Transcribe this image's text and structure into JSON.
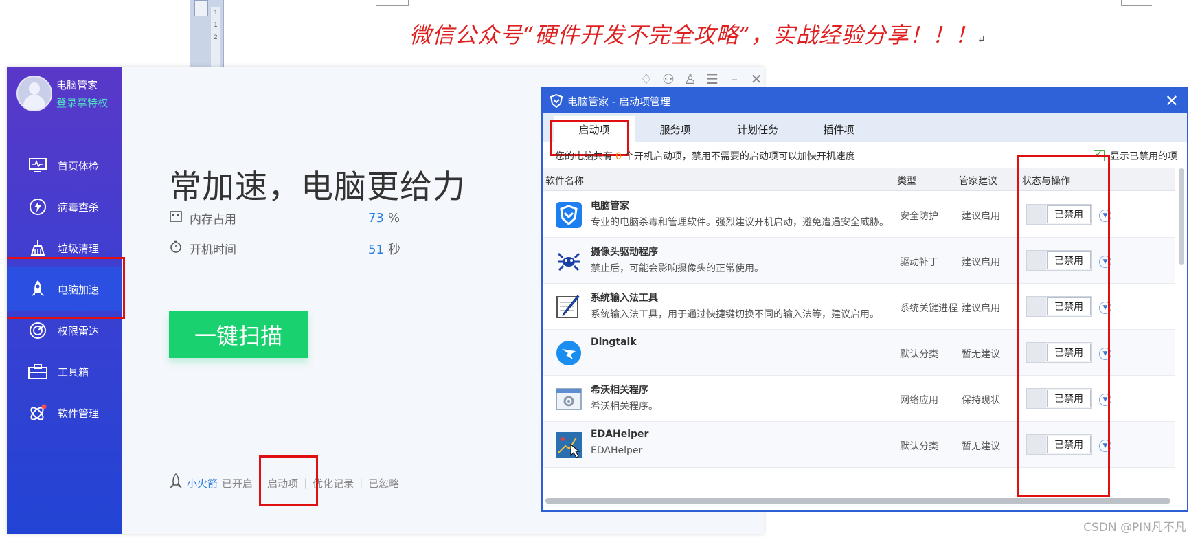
{
  "document": {
    "headline": "微信公众号“硬件开发不完全攻略”，实战经验分享！！！",
    "paragraph_mark": "↵",
    "ruler_ticks": [
      "1",
      "1",
      "2"
    ],
    "watermark": "CSDN @PIN凡不凡"
  },
  "app": {
    "user": {
      "name": "电脑管家",
      "login": "登录享特权"
    },
    "nav": [
      {
        "label": "首页体检",
        "icon": "monitor-check-icon"
      },
      {
        "label": "病毒查杀",
        "icon": "lightning-shield-icon"
      },
      {
        "label": "垃圾清理",
        "icon": "broom-icon"
      },
      {
        "label": "电脑加速",
        "icon": "rocket-icon",
        "active": true
      },
      {
        "label": "权限雷达",
        "icon": "radar-icon"
      },
      {
        "label": "工具箱",
        "icon": "toolbox-icon"
      },
      {
        "label": "软件管理",
        "icon": "apps-icon"
      }
    ],
    "main": {
      "title": "常加速，电脑更给力",
      "memory_label": "内存占用",
      "memory_value": "73",
      "memory_unit": "%",
      "boot_label": "开机时间",
      "boot_value": "51",
      "boot_unit": "秒",
      "scan_button": "一键扫描",
      "footer": {
        "rocket_link": "小火箭",
        "rocket_status": "已开启",
        "startup_link": "启动项",
        "history_link": "优化记录",
        "ignored_link": "已忽略"
      }
    }
  },
  "dialog": {
    "title": "电脑管家 - 启动项管理",
    "close": "✕",
    "tabs": [
      "启动项",
      "服务项",
      "计划任务",
      "插件项"
    ],
    "active_tab": "启动项",
    "info_prefix": "您的电脑共有",
    "info_count": "0",
    "info_suffix": "个开机启动项，禁用不需要的启动项可以加快开机速度",
    "show_disabled": "显示已禁用的项",
    "columns": {
      "name": "软件名称",
      "type": "类型",
      "advice": "管家建议",
      "status": "状态与操作"
    },
    "rows": [
      {
        "name": "电脑管家",
        "desc": "专业的电脑杀毒和管理软件。强烈建议开机启动，避免遭遇安全威胁。",
        "type": "安全防护",
        "advice": "建议启用",
        "status": "已禁用",
        "icon": "tencent-shield-icon"
      },
      {
        "name": "摄像头驱动程序",
        "desc": "禁止后，可能会影响摄像头的正常使用。",
        "type": "驱动补丁",
        "advice": "建议启用",
        "status": "已禁用",
        "icon": "realtek-crab-icon"
      },
      {
        "name": "系统输入法工具",
        "desc": "系统输入法工具，用于通过快捷键切换不同的输入法等，建议启用。",
        "type": "系统关键进程",
        "advice": "建议启用",
        "status": "已禁用",
        "icon": "pen-notepad-icon"
      },
      {
        "name": "Dingtalk",
        "desc": "",
        "type": "默认分类",
        "advice": "暂无建议",
        "status": "已禁用",
        "icon": "dingtalk-icon"
      },
      {
        "name": "希沃相关程序",
        "desc": "希沃相关程序。",
        "type": "网络应用",
        "advice": "保持现状",
        "status": "已禁用",
        "icon": "window-gear-icon"
      },
      {
        "name": "EDAHelper",
        "desc": "EDAHelper",
        "type": "默认分类",
        "advice": "暂无建议",
        "status": "已禁用",
        "icon": "eda-helper-icon"
      }
    ]
  },
  "colors": {
    "sidebar": "#3d3fd1",
    "accent_blue": "#2a7de0",
    "scan_green": "#19d26f",
    "highlight_red": "#e01010",
    "dialog_blue": "#2f62d8"
  }
}
